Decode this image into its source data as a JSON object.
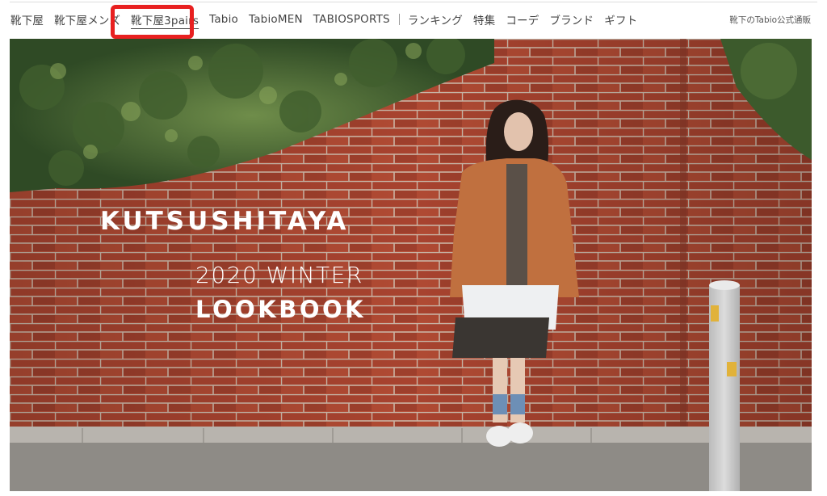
{
  "nav": {
    "items": [
      {
        "label": "靴下屋"
      },
      {
        "label": "靴下屋メンズ"
      },
      {
        "label": "靴下屋3pairs"
      },
      {
        "label": "Tabio"
      },
      {
        "label": "TabioMEN"
      },
      {
        "label": "TABIOSPORTS"
      },
      {
        "label": "ランキング"
      },
      {
        "label": "特集"
      },
      {
        "label": "コーデ"
      },
      {
        "label": "ブランド"
      },
      {
        "label": "ギフト"
      }
    ],
    "site_tag": "靴下のTabio公式通販"
  },
  "annotation": {
    "color": "#e82020",
    "highlighted_item": "靴下屋3pairs"
  },
  "hero": {
    "brand": "KUTSUSHITAYA",
    "season": "2020 WINTER",
    "title": "LOOKBOOK"
  }
}
